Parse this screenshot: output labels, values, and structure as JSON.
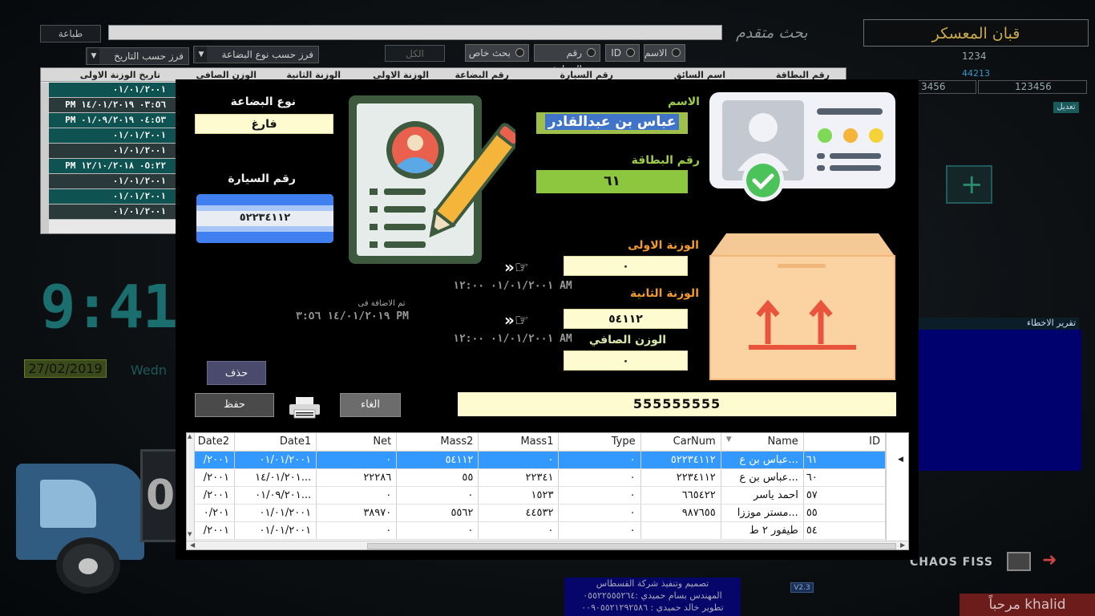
{
  "background": {
    "print_button": "طباعة",
    "advanced_search_label": "بحث متقدم",
    "sort_by_goods": "فرز حسب نوع البضاعة",
    "sort_by_date": "فرز حسب التاريخ",
    "all_button": "الكل",
    "radios": [
      "الاسم",
      "ID",
      "رقم السيارة",
      "بحث خاص"
    ],
    "grid_headers": [
      "رقم البطاقة",
      "اسم السائق",
      "رقم السيارة",
      "رقم البضاعة",
      "الوزنة الاولى",
      "الوزنة الثانية",
      "الوزن الصافي",
      "تاريخ الوزنة الاولى"
    ],
    "grid_dates": [
      "٠١/٠١/٢٠٠١",
      "PM ٠٣:٥٦ ١٤/٠١/٢٠١٩",
      "PM ٠٤:٥٣ ٠١/٠٩/٢٠١٩",
      "٠١/٠١/٢٠٠١",
      "٠١/٠١/٢٠٠١",
      "PM ٠٥:٢٢ ١٢/١٠/٢٠١٨",
      "٠١/٠١/٢٠٠١",
      "٠١/٠١/٢٠٠١",
      "٠١/٠١/٢٠٠١"
    ],
    "company_name": "قبان المعسكر",
    "company_code": "1234",
    "company_small": "44213",
    "field_a": "123456",
    "field_b": "3456",
    "edit_button": "تعديل",
    "clock": "9:41:",
    "date": "27/02/2019",
    "weekday_partial": "Wedn",
    "truck_digit": "0",
    "errors_title": "تقرير الاخطاء",
    "credits": [
      "تصميم وتنفيذ شركة القسطاس",
      "المهندس بسام حميدي :٠٥٥٢٢٥٥٥٢٦٤",
      "تطوير خالد حميدي : ٠٠٩٠٥٥٢١٢٩٢٥٨٦"
    ],
    "version": "V2.3",
    "brand": "CHAOS FISS",
    "welcome": "مرحباً khalid"
  },
  "modal": {
    "goods_type_label": "نوع البضاعة",
    "goods_type_value": "فارغ",
    "car_number_label": "رقم السيارة",
    "car_number_value": "٥٢٢٣٤١١٢",
    "name_label": "الاسم",
    "name_value": "عباس بن عبدالقادر",
    "card_number_label": "رقم البطاقة",
    "card_number_value": "٦١",
    "first_weight_label": "الوزنة الاولى",
    "first_weight_value": "٠",
    "first_weight_date": "٠١/٠١/٢٠٠١ ١٢:٠٠ AM",
    "second_weight_label": "الوزنة الثانية",
    "second_weight_value": "٥٤١١٢",
    "second_weight_date": "٠١/٠١/٢٠٠١ ١٢:٠٠ AM",
    "net_weight_label": "الوزن الصافي",
    "net_weight_value": "٠",
    "added_on_label": "تم الاضافة فى",
    "added_on_value": "١٤/٠١/٢٠١٩ ٣:٥٦ PM",
    "delete_button": "حذف",
    "save_button": "حفظ",
    "cancel_button": "الغاء",
    "total_value": "555555555",
    "pointer_glyph": "»☞"
  },
  "data_grid": {
    "columns": [
      "Date2",
      "Date1",
      "Net",
      "Mass2",
      "Mass1",
      "Type",
      "CarNum",
      "Name",
      "ID"
    ],
    "rows": [
      {
        "date2": "/٢٠٠١",
        "date1": "٠١/٠١/٢٠٠١",
        "net": "٠",
        "mass2": "٥٤١١٢",
        "mass1": "٠",
        "type": "٠",
        "carnum": "٥٢٢٣٤١١٢",
        "name": "عباس بن ع...",
        "id": "٦١"
      },
      {
        "date2": "/٢٠٠١",
        "date1": "١٤/٠١/٢٠١...",
        "net": "٢٢٢٨٦",
        "mass2": "٥٥",
        "mass1": "٢٢٣٤١",
        "type": "٠",
        "carnum": "٢٢٣٤١١٢",
        "name": "عباس بن ع...",
        "id": "٦٠"
      },
      {
        "date2": "/٢٠٠١",
        "date1": "٠١/٠٩/٢٠١...",
        "net": "٠",
        "mass2": "٠",
        "mass1": "١٥٢٣",
        "type": "٠",
        "carnum": "٦٦٥٤٢٢",
        "name": "احمد ياسر",
        "id": "٥٧"
      },
      {
        "date2": "٠/٢٠١",
        "date1": "٠١/٠١/٢٠٠١",
        "net": "٣٨٩٧٠",
        "mass2": "٥٥٦٢",
        "mass1": "٤٤٥٣٢",
        "type": "٠",
        "carnum": "٩٨٧٦٥٥",
        "name": "مستر موززا...",
        "id": "٥٥"
      },
      {
        "date2": "/٢٠٠١",
        "date1": "٠١/٠١/٢٠٠١",
        "net": "٠",
        "mass2": "٠",
        "mass1": "٠",
        "type": "٠",
        "carnum": "",
        "name": "طيفور ٢ ط",
        "id": "٥٤"
      }
    ]
  },
  "colors": {
    "accent_green": "#8dc63f",
    "selection_blue": "#3399ff",
    "field_yellow": "#fffbd0",
    "label_orange": "#f29a2e"
  },
  "icons": [
    "id-card-check-icon",
    "document-edit-icon",
    "box-this-side-up-icon",
    "car-plate-icon",
    "printer-icon",
    "pointing-hand-icon"
  ]
}
